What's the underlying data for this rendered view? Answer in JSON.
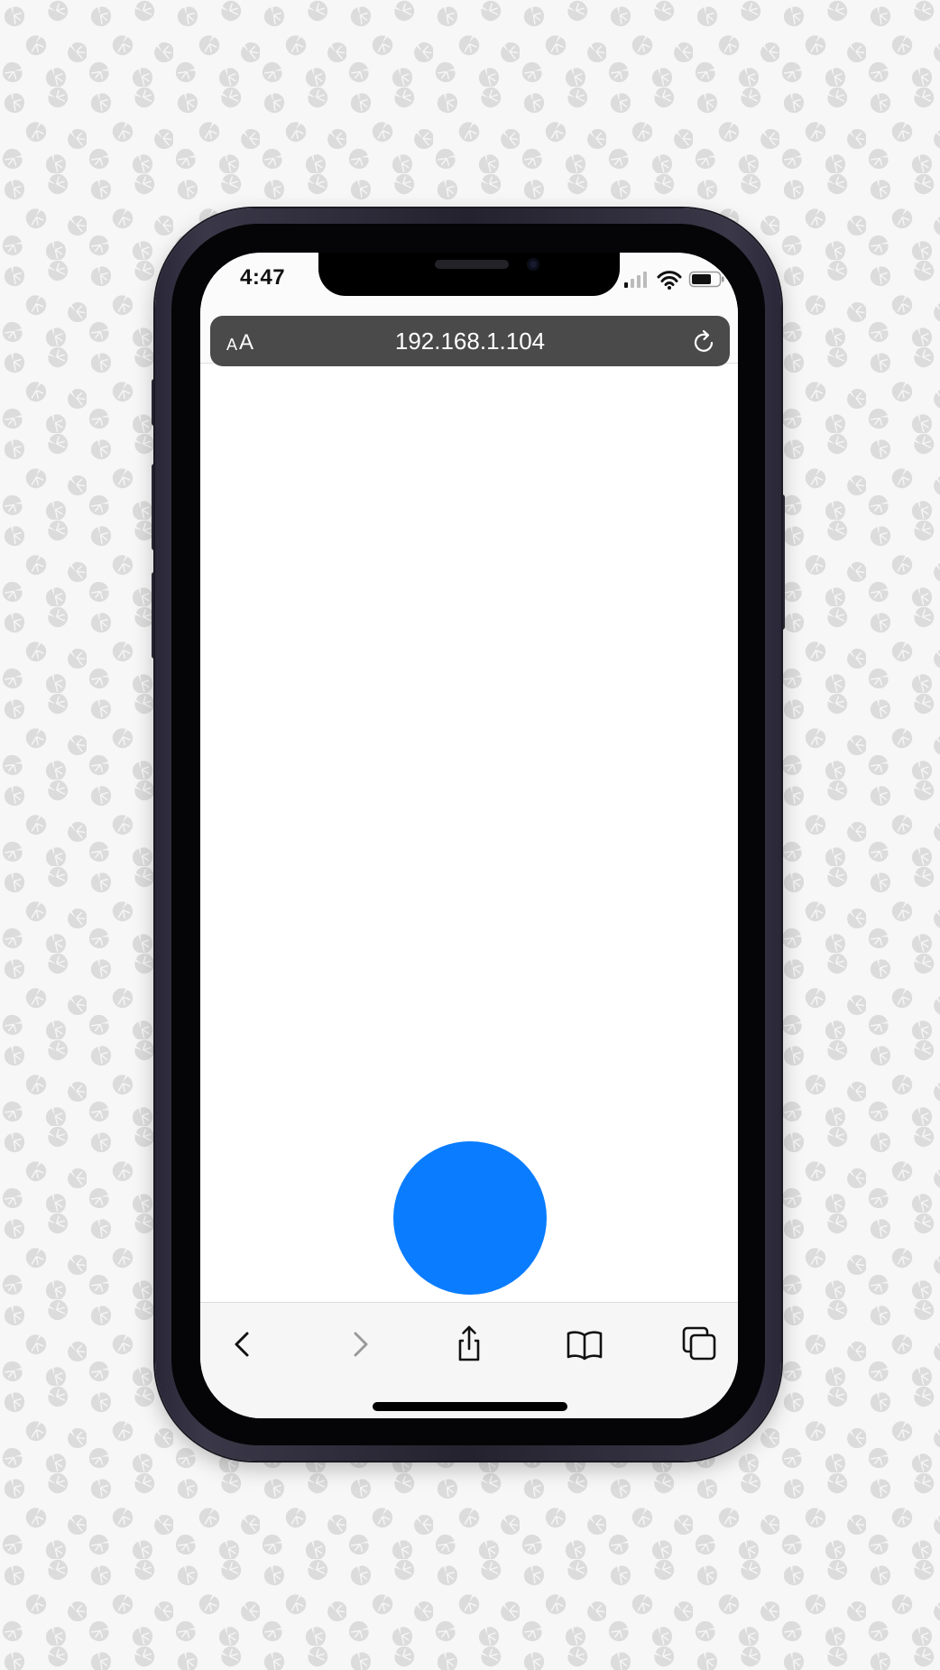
{
  "status_bar": {
    "time": "4:47"
  },
  "browser": {
    "text_size_small": "A",
    "text_size_large": "A",
    "url": "192.168.1.104",
    "reload_icon": "reload-icon"
  },
  "content": {
    "circle_color": "#0a7cff"
  },
  "toolbar": {
    "back_icon": "chevron-left-icon",
    "forward_icon": "chevron-right-icon",
    "share_icon": "share-icon",
    "bookmarks_icon": "book-icon",
    "tabs_icon": "tabs-icon"
  },
  "colors": {
    "accent": "#0a7cff",
    "url_bar": "#4a4a4a",
    "phone_frame": "#2a2838"
  }
}
